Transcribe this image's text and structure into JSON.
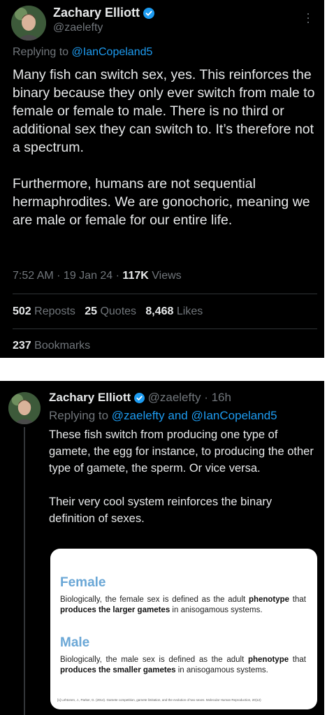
{
  "tweet1": {
    "author": {
      "name": "Zachary Elliott",
      "handle": "@zaelefty"
    },
    "replying_label": "Replying to",
    "replying_to": "@IanCopeland5",
    "paragraph1": "Many fish can switch sex, yes. This reinforces the binary because they only ever switch from male to female or female to male. There is no third or additional sex they can switch to. It’s therefore not a spectrum.",
    "paragraph2": "Furthermore, humans are not sequential hermaphrodites. We are gonochoric, meaning we are male or female for our entire life.",
    "time": "7:52 AM",
    "date": "19 Jan 24",
    "views_count": "117K",
    "views_label": "Views",
    "reposts_count": "502",
    "reposts_label": "Reposts",
    "quotes_count": "25",
    "quotes_label": "Quotes",
    "likes_count": "8,468",
    "likes_label": "Likes",
    "bookmarks_count": "237",
    "bookmarks_label": "Bookmarks"
  },
  "tweet2": {
    "author": {
      "name": "Zachary Elliott",
      "handle": "@zaelefty",
      "age": "16h"
    },
    "replying_label": "Replying to",
    "replying_to_1": "@zaelefty",
    "replying_and": "and",
    "replying_to_2": "@IanCopeland5",
    "paragraph1": "These fish switch from producing one type of gamete, the egg for instance, to producing the other type of gamete, the sperm. Or vice versa.",
    "paragraph2": "Their very cool system reinforces the binary definition of sexes.",
    "image": {
      "female_heading": "Female",
      "female_text_1": "Biologically, the female sex is defined as the adult ",
      "female_bold_1": "phenotype",
      "female_text_2": " that ",
      "female_bold_2": "produces the larger gametes",
      "female_text_3": " in anisogamous systems.",
      "male_heading": "Male",
      "male_text_1": "Biologically, the male sex is defined as the adult ",
      "male_bold_1": "phenotype",
      "male_text_2": " that ",
      "male_bold_2": "produces the smaller gametes",
      "male_text_3": " in anisogamous systems.",
      "reference": "[1] Lehtonen, J., Parker, G. (2014). Gamete competition, gamete limitation, and the evolution of two sexes. Molecular Human Reproduction, 20(12)"
    }
  },
  "colors": {
    "accent": "#1d9bf0",
    "muted": "#71767b",
    "text": "#e7e9ea",
    "background": "#000000",
    "card_heading": "#6aa7d6"
  }
}
